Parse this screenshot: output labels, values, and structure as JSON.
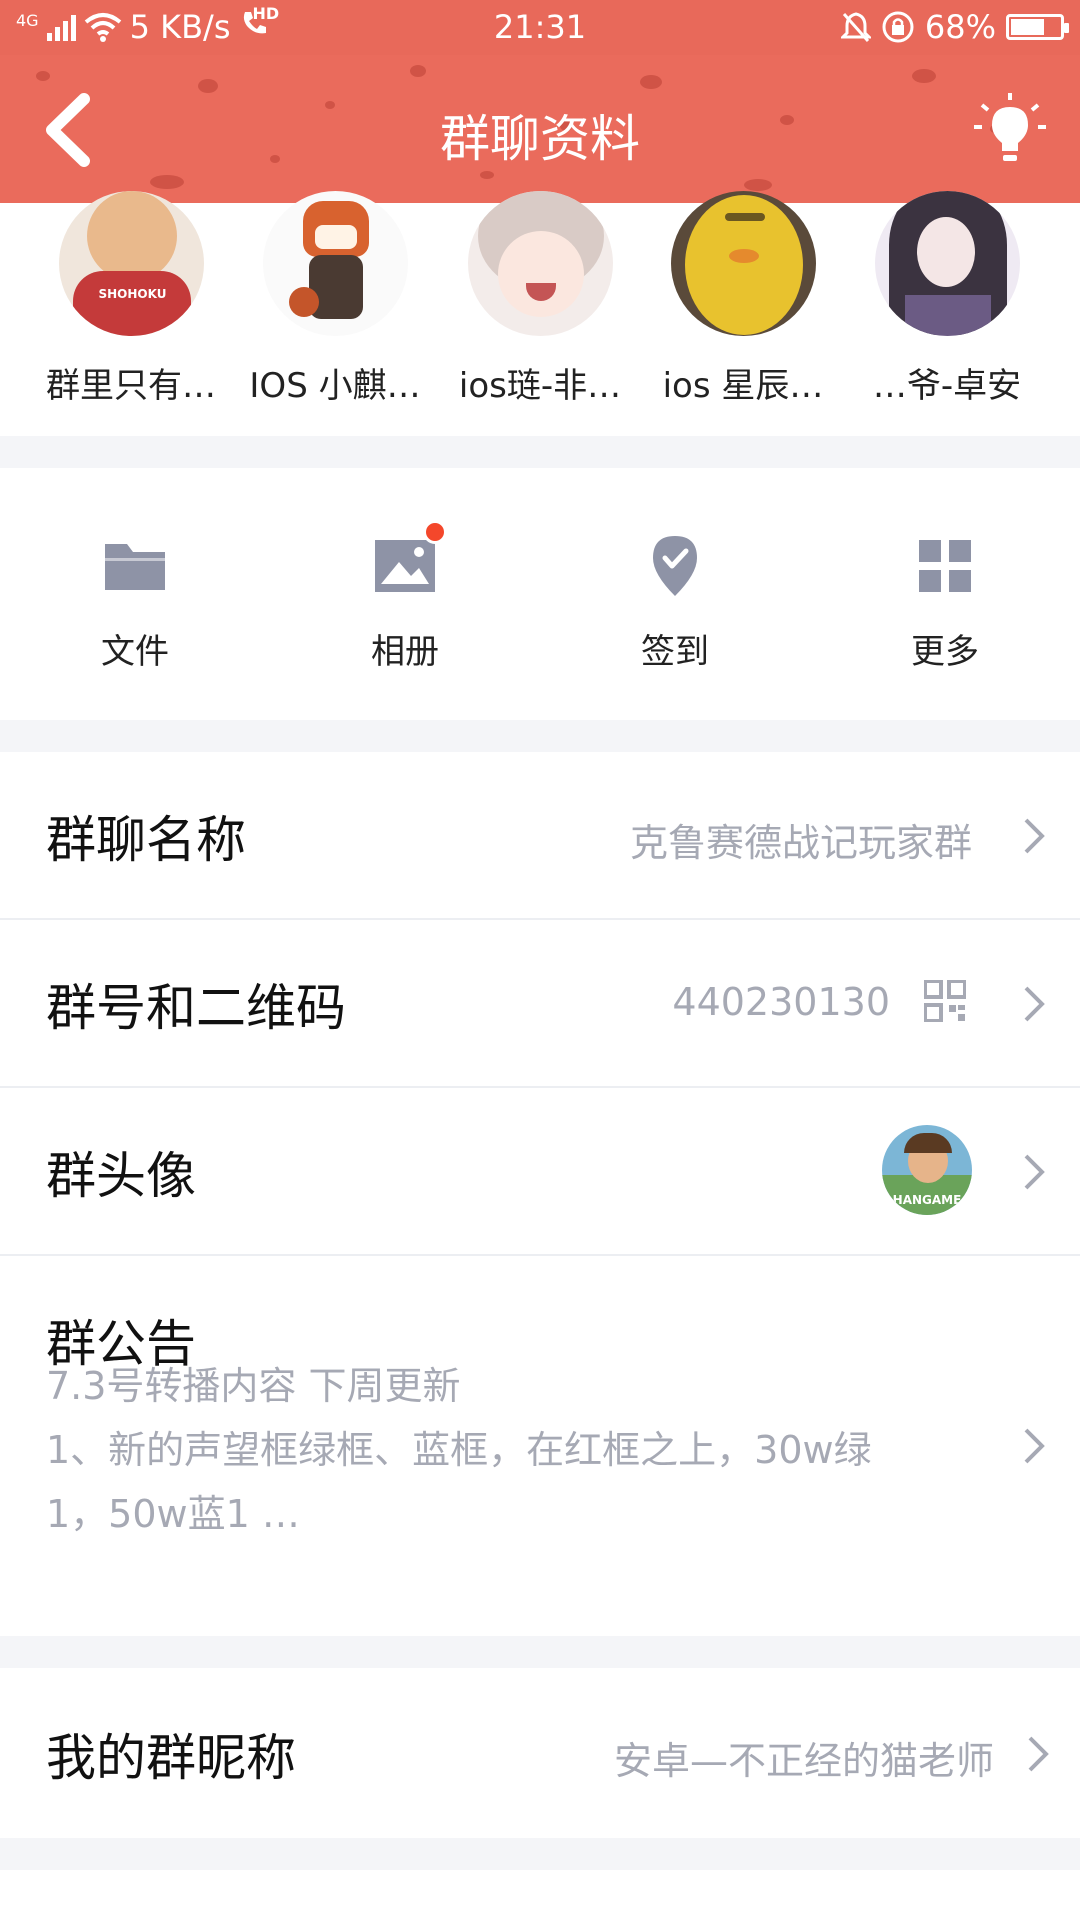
{
  "statusbar": {
    "network": "4G",
    "speed": "5 KB/s",
    "hd": "HD",
    "time": "21:31",
    "battery": "68%",
    "battery_level": 0.68
  },
  "header": {
    "title": "群聊资料",
    "color": "#ea6b5c",
    "back_icon": "chevron-left-icon",
    "right_icon": "lightbulb-icon"
  },
  "members": [
    {
      "name": "群里只有…",
      "avatar_color": "#d9c4b0"
    },
    {
      "name": "IOS 小麒…",
      "avatar_color": "#f2e7dc"
    },
    {
      "name": "ios琏-非…",
      "avatar_color": "#eadcd6"
    },
    {
      "name": "ios 星辰…",
      "avatar_color": "#e6c33a"
    },
    {
      "name": "…爷-卓安",
      "avatar_color": "#3c3540"
    }
  ],
  "tools": [
    {
      "label": "文件",
      "icon": "folder-icon"
    },
    {
      "label": "相册",
      "icon": "photo-album-icon",
      "has_badge": true
    },
    {
      "label": "签到",
      "icon": "check-in-icon"
    },
    {
      "label": "更多",
      "icon": "grid-more-icon"
    }
  ],
  "group_name": {
    "label": "群聊名称",
    "value": "克鲁赛德战记玩家群"
  },
  "group_id": {
    "label": "群号和二维码",
    "value": "440230130"
  },
  "group_avatar": {
    "label": "群头像",
    "avatar_text": "HANGAME"
  },
  "notice": {
    "label": "群公告",
    "line1": "7.3号转播内容 下周更新",
    "line2": "1、新的声望框绿框、蓝框，在红框之上，30w绿",
    "line3": "1，50w蓝1 …"
  },
  "nickname": {
    "label": "我的群昵称",
    "value": "安卓—不正经的猫老师"
  },
  "colors": {
    "accent": "#ea6b5c",
    "icon_gray": "#8e93a6",
    "value_gray": "#a6a9b4",
    "badge_red": "#f4472b"
  }
}
